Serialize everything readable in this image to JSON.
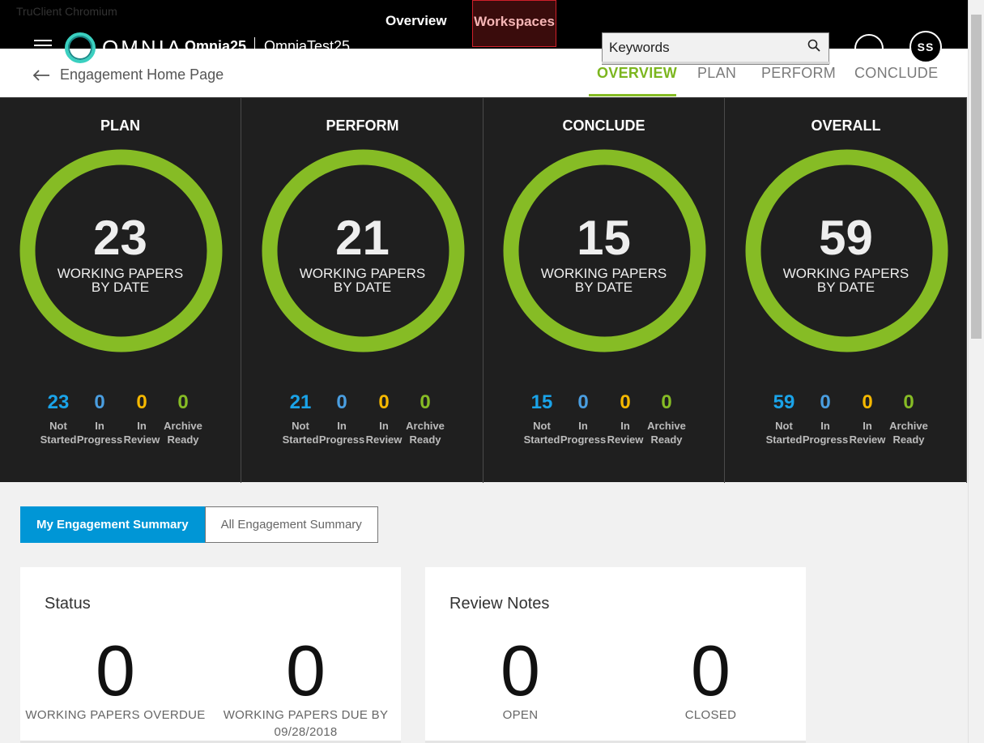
{
  "browser": {
    "title": "TruClient Chromium"
  },
  "app": {
    "logo_text": "OMNIA",
    "client": "Omnia25",
    "engagement": "OmniaTest25",
    "nav": [
      {
        "label": "Overview"
      },
      {
        "label": "Workspaces"
      }
    ],
    "search_placeholder": "Keywords",
    "avatar_initials": "SS"
  },
  "header": {
    "back_label": "Engagement Home Page",
    "tabs": [
      {
        "label": "OVERVIEW",
        "active": true
      },
      {
        "label": "PLAN"
      },
      {
        "label": "PERFORM"
      },
      {
        "label": "CONCLUDE"
      }
    ]
  },
  "colors": {
    "ring": "#86bc25",
    "not_started": "#1aa3e8",
    "in_progress": "#4a9ee0",
    "in_review": "#f5b800",
    "archive_ready": "#86bc25"
  },
  "panels": [
    {
      "title": "PLAN",
      "total": "23",
      "label_line1": "WORKING PAPERS",
      "label_line2": "BY DATE",
      "stats": [
        {
          "value": "23",
          "l1": "Not",
          "l2": "Started"
        },
        {
          "value": "0",
          "l1": "In",
          "l2": "Progress"
        },
        {
          "value": "0",
          "l1": "In",
          "l2": "Review"
        },
        {
          "value": "0",
          "l1": "Archive",
          "l2": "Ready"
        }
      ]
    },
    {
      "title": "PERFORM",
      "total": "21",
      "label_line1": "WORKING PAPERS",
      "label_line2": "BY DATE",
      "stats": [
        {
          "value": "21",
          "l1": "Not",
          "l2": "Started"
        },
        {
          "value": "0",
          "l1": "In",
          "l2": "Progress"
        },
        {
          "value": "0",
          "l1": "In",
          "l2": "Review"
        },
        {
          "value": "0",
          "l1": "Archive",
          "l2": "Ready"
        }
      ]
    },
    {
      "title": "CONCLUDE",
      "total": "15",
      "label_line1": "WORKING PAPERS",
      "label_line2": "BY DATE",
      "stats": [
        {
          "value": "15",
          "l1": "Not",
          "l2": "Started"
        },
        {
          "value": "0",
          "l1": "In",
          "l2": "Progress"
        },
        {
          "value": "0",
          "l1": "In",
          "l2": "Review"
        },
        {
          "value": "0",
          "l1": "Archive",
          "l2": "Ready"
        }
      ]
    },
    {
      "title": "OVERALL",
      "total": "59",
      "label_line1": "WORKING PAPERS",
      "label_line2": "BY DATE",
      "stats": [
        {
          "value": "59",
          "l1": "Not",
          "l2": "Started"
        },
        {
          "value": "0",
          "l1": "In",
          "l2": "Progress"
        },
        {
          "value": "0",
          "l1": "In",
          "l2": "Review"
        },
        {
          "value": "0",
          "l1": "Archive",
          "l2": "Ready"
        }
      ]
    }
  ],
  "summary_toggle": {
    "my": "My Engagement Summary",
    "all": "All Engagement Summary"
  },
  "status_card": {
    "title": "Status",
    "metrics": [
      {
        "value": "0",
        "caption_l1": "WORKING PAPERS OVERDUE",
        "caption_l2": ""
      },
      {
        "value": "0",
        "caption_l1": "WORKING PAPERS DUE BY",
        "caption_l2": "09/28/2018"
      }
    ]
  },
  "review_card": {
    "title": "Review Notes",
    "metrics": [
      {
        "value": "0",
        "caption_l1": "OPEN"
      },
      {
        "value": "0",
        "caption_l1": "CLOSED"
      }
    ]
  }
}
